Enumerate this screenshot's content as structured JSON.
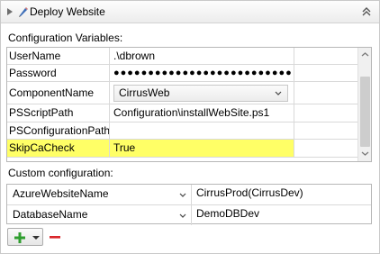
{
  "header": {
    "title": "Deploy Website",
    "icons": [
      "expand-arrow-icon",
      "edit-pencil-icon",
      "collapse-icon"
    ]
  },
  "config_variables": {
    "label": "Configuration Variables:",
    "rows": [
      {
        "name": "UserName",
        "value": ".\\dbrown"
      },
      {
        "name": "Password",
        "value": "●●●●●●●●●●●●●●●●●●●●●●●●●●●●●●"
      },
      {
        "name": "ComponentName",
        "value": "CirrusWeb"
      },
      {
        "name": "PSScriptPath",
        "value": "Configuration\\installWebSite.ps1"
      },
      {
        "name": "PSConfigurationPath",
        "value": ""
      },
      {
        "name": "SkipCaCheck",
        "value": "True"
      }
    ],
    "highlight_color": "#ffff66"
  },
  "custom_config": {
    "label": "Custom configuration:",
    "rows": [
      {
        "key": "AzureWebsiteName",
        "value": "CirrusProd(CirrusDev)"
      },
      {
        "key": "DatabaseName",
        "value": "DemoDBDev"
      }
    ]
  },
  "colors": {
    "add": "#2f9e2f",
    "remove": "#d9262b"
  }
}
